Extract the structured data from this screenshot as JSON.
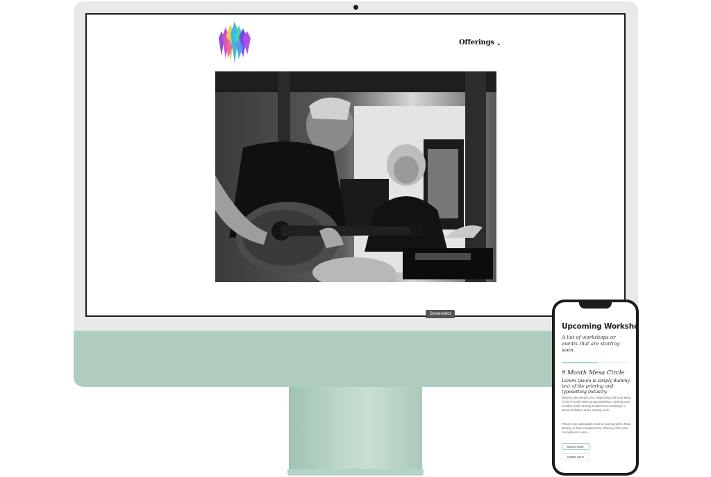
{
  "website": {
    "nav": {
      "offerings_label": "Offerings",
      "offerings_chevron": "chevron-down-icon"
    },
    "logo_icon": "crystal-logo-icon",
    "hero_image": "black-and-white-photo-guitarist-and-singer"
  },
  "tooltip": {
    "label": "Screenshot"
  },
  "phone": {
    "title": "Upcoming Workshops",
    "subtitle": "A list of workshops or events that are starting soon.",
    "workshop": {
      "title": "9 Month Mesa Circle",
      "lead": "Lorem Ipsum is simply dummy text of the printing and typesetting industry.",
      "body1": "Network and deepen your relationship with your Mesa in this 9-month online group workshop, meeting once monthly. Each meeting includes new teachings, a Mesa meditation and a sharing circle.",
      "body2": "Please note participants must be working with a Mesa already, or have completed the Alchemy of the Altar: Foundations course.",
      "booknow_label": "BOOK NOW",
      "moreinfo_label": "MORE INFO"
    }
  },
  "colors": {
    "imac_body": "#aecdbe",
    "accent": "#a7d7cf"
  }
}
